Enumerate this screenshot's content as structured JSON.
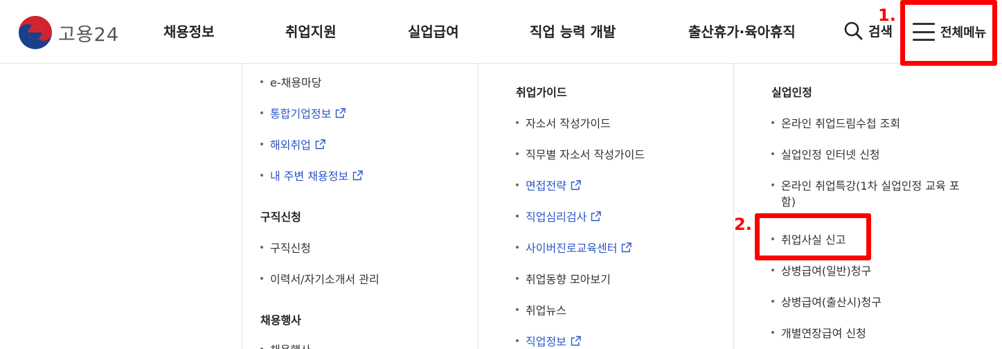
{
  "header": {
    "logo_text": "고용24",
    "nav": [
      "채용정보",
      "취업지원",
      "실업급여",
      "직업 능력 개발",
      "출산휴가·육아휴직"
    ],
    "search_label": "검색",
    "allmenu_label": "전체메뉴"
  },
  "annotations": [
    "1.",
    "2."
  ],
  "col1": {
    "items_top": [
      {
        "label": "e-채용마당",
        "link": false
      },
      {
        "label": "통합기업정보",
        "link": true
      },
      {
        "label": "해외취업",
        "link": true
      },
      {
        "label": "내 주변 채용정보",
        "link": true
      }
    ],
    "section2_title": "구직신청",
    "section2_items": [
      "구직신청",
      "이력서/자기소개서 관리"
    ],
    "section3_title": "채용행사",
    "section3_items": [
      "채용행사"
    ]
  },
  "col2": {
    "title": "취업가이드",
    "items": [
      {
        "label": "자소서 작성가이드",
        "link": false
      },
      {
        "label": "직무별 자소서 작성가이드",
        "link": false
      },
      {
        "label": "면접전략",
        "link": true
      },
      {
        "label": "직업심리검사",
        "link": true
      },
      {
        "label": "사이버진로교육센터",
        "link": true
      },
      {
        "label": "취업동향 모아보기",
        "link": false
      },
      {
        "label": "취업뉴스",
        "link": false
      },
      {
        "label": "직업정보",
        "link": true
      }
    ]
  },
  "col3": {
    "title": "실업인정",
    "items": [
      "온라인 취업드림수첩 조회",
      "실업인정 인터넷 신청",
      "온라인 취업특강(1차 실업인정 교육 포",
      "취업사실 신고",
      "상병급여(일반)청구",
      "상병급여(출산시)청구",
      "개별연장급여 신청"
    ],
    "item3_wrap": "함)"
  },
  "colors": {
    "link": "#2b55c9",
    "annotation": "#ff0000"
  }
}
